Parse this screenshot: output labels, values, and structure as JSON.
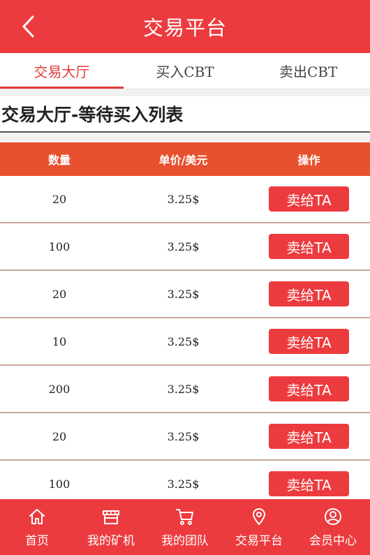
{
  "header": {
    "title": "交易平台"
  },
  "tabs": [
    {
      "label": "交易大厅",
      "active": true
    },
    {
      "label": "买入CBT",
      "active": false
    },
    {
      "label": "卖出CBT",
      "active": false
    }
  ],
  "section": {
    "title": "交易大厅-等待买入列表"
  },
  "table": {
    "headers": {
      "qty": "数量",
      "price": "单价/美元",
      "op": "操作"
    },
    "rows": [
      {
        "qty": "20",
        "price": "3.25$",
        "action": "卖给TA"
      },
      {
        "qty": "100",
        "price": "3.25$",
        "action": "卖给TA"
      },
      {
        "qty": "20",
        "price": "3.25$",
        "action": "卖给TA"
      },
      {
        "qty": "10",
        "price": "3.25$",
        "action": "卖给TA"
      },
      {
        "qty": "200",
        "price": "3.25$",
        "action": "卖给TA"
      },
      {
        "qty": "20",
        "price": "3.25$",
        "action": "卖给TA"
      },
      {
        "qty": "100",
        "price": "3.25$",
        "action": "卖给TA"
      }
    ]
  },
  "nav": [
    {
      "label": "首页",
      "icon": "home-icon"
    },
    {
      "label": "我的矿机",
      "icon": "store-icon"
    },
    {
      "label": "我的团队",
      "icon": "cart-icon"
    },
    {
      "label": "交易平台",
      "icon": "location-pin-icon"
    },
    {
      "label": "会员中心",
      "icon": "user-icon"
    }
  ],
  "colors": {
    "primary": "#ec3b3e",
    "table_header": "#e8512f",
    "active_tab": "#e23c3c"
  }
}
